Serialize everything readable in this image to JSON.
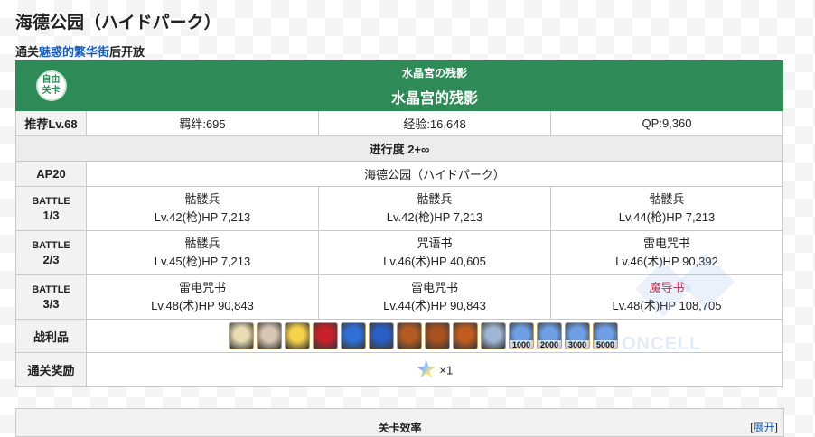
{
  "page": {
    "title": "海德公园（ハイドパーク）",
    "unlock_prefix": "通关",
    "unlock_link": "魅惑的繁华街",
    "unlock_suffix": "后开放"
  },
  "quest": {
    "badge_line1": "自由",
    "badge_line2": "关卡",
    "name_jp": "水晶宮の残影",
    "name_cn": "水晶宫的残影",
    "recommended_level": "推荐Lv.68",
    "bond": "羁绊:695",
    "exp": "经验:16,648",
    "qp": "QP:9,360",
    "progress": "进行度 2+∞",
    "ap": "AP20",
    "location": "海德公园（ハイドパーク）"
  },
  "battles": [
    {
      "label_line1": "BATTLE",
      "label_line2": "1/3",
      "enemies": [
        {
          "name": "骷髅兵",
          "stats": "Lv.42(枪)HP 7,213"
        },
        {
          "name": "骷髅兵",
          "stats": "Lv.42(枪)HP 7,213"
        },
        {
          "name": "骷髅兵",
          "stats": "Lv.44(枪)HP 7,213"
        }
      ]
    },
    {
      "label_line1": "BATTLE",
      "label_line2": "2/3",
      "enemies": [
        {
          "name": "骷髅兵",
          "stats": "Lv.45(枪)HP 7,213"
        },
        {
          "name": "咒语书",
          "stats": "Lv.46(术)HP 40,605"
        },
        {
          "name": "雷电咒书",
          "stats": "Lv.46(术)HP 90,392"
        }
      ]
    },
    {
      "label_line1": "BATTLE",
      "label_line2": "3/3",
      "enemies": [
        {
          "name": "雷电咒书",
          "stats": "Lv.48(术)HP 90,843"
        },
        {
          "name": "雷电咒书",
          "stats": "Lv.44(术)HP 90,843"
        },
        {
          "name": "魔导书",
          "stats": "Lv.48(术)HP 108,705",
          "highlight": true
        }
      ]
    }
  ],
  "drops": {
    "label": "战利品",
    "items": [
      {
        "icon": "scroll-material-icon",
        "color": "#e8dcb0"
      },
      {
        "icon": "bone-material-icon",
        "color": "#d9c7b4"
      },
      {
        "icon": "gold-star-material-icon",
        "color": "#f6d24a"
      },
      {
        "icon": "red-gem-material-icon",
        "color": "#c8202a"
      },
      {
        "icon": "blue-gem-icon",
        "color": "#2f6fd6"
      },
      {
        "icon": "blue-magic-gem-icon",
        "color": "#2a5ec4"
      },
      {
        "icon": "fire-ember-icon-1",
        "color": "#b55a22"
      },
      {
        "icon": "fire-ember-icon-2",
        "color": "#a8501e"
      },
      {
        "icon": "fire-ember-icon-3",
        "color": "#c05c20"
      },
      {
        "icon": "crystal-orb-icon",
        "color": "#9fb7d6"
      },
      {
        "icon": "blue-qp-icon-1",
        "color": "#6fa0e6",
        "count": "1000"
      },
      {
        "icon": "blue-qp-icon-2",
        "color": "#6fa0e6",
        "count": "2000"
      },
      {
        "icon": "blue-qp-icon-3",
        "color": "#6fa0e6",
        "count": "3000"
      },
      {
        "icon": "blue-qp-icon-4",
        "color": "#6fa0e6",
        "count": "5000"
      }
    ]
  },
  "reward": {
    "label": "通关奖励",
    "icon": "saint-quartz-icon",
    "count": "×1"
  },
  "next_panel": {
    "title": "关卡效率",
    "expand_open": "[",
    "expand_link": "展开",
    "expand_close": "]"
  },
  "watermark": "ONCELL"
}
